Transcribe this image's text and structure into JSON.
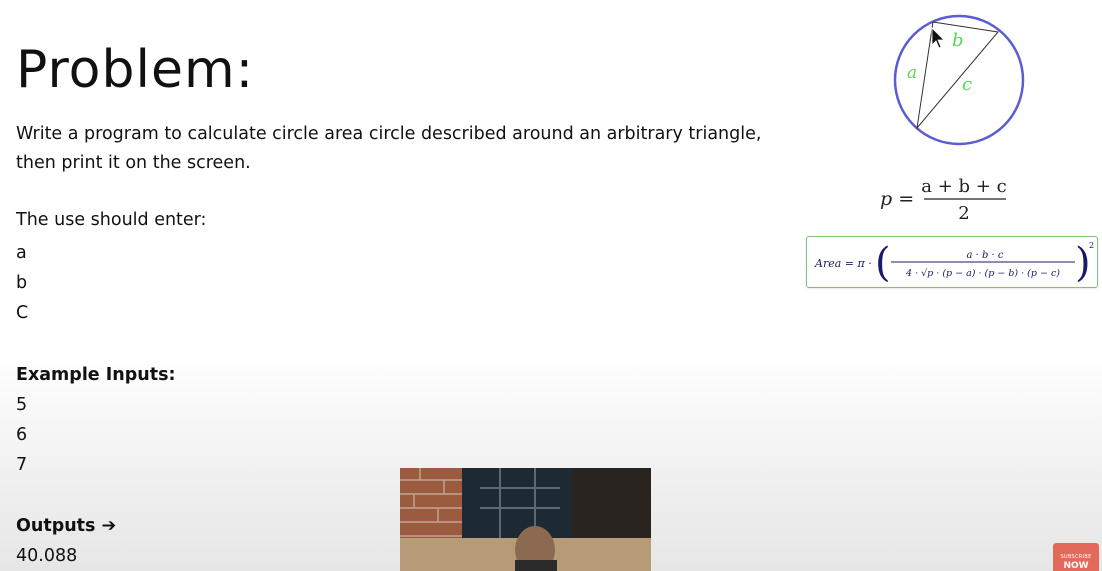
{
  "problem": {
    "title": "Problem:",
    "description": "Write a program to calculate  circle area circle described around an arbitrary triangle, then print it on the screen.",
    "prompt": "The use should enter:",
    "inputs": [
      "a",
      "b",
      "C"
    ],
    "example_heading": "Example Inputs:",
    "example_values": [
      "5",
      "6",
      "7"
    ],
    "outputs_label": "Outputs ➔",
    "output_value": "40.088"
  },
  "diagram": {
    "label_a": "a",
    "label_b": "b",
    "label_c": "c",
    "circle_color": "#5b5bd6",
    "side_label_color": "#58d658"
  },
  "formulas": {
    "p_lhs": "p =",
    "p_numerator": "a + b + c",
    "p_denominator": "2",
    "area_lhs": "Area = π ·",
    "area_numerator": "a · b · c",
    "area_denominator": "4 · √p · (p − a) · (p − b) · (p − c)",
    "area_exponent": "2",
    "box_border_color": "#7bc27b"
  },
  "overlay": {
    "subscribe_small": "SUBSCRIBE",
    "subscribe_big": "NOW",
    "subscribe_color": "#e36a5b"
  }
}
